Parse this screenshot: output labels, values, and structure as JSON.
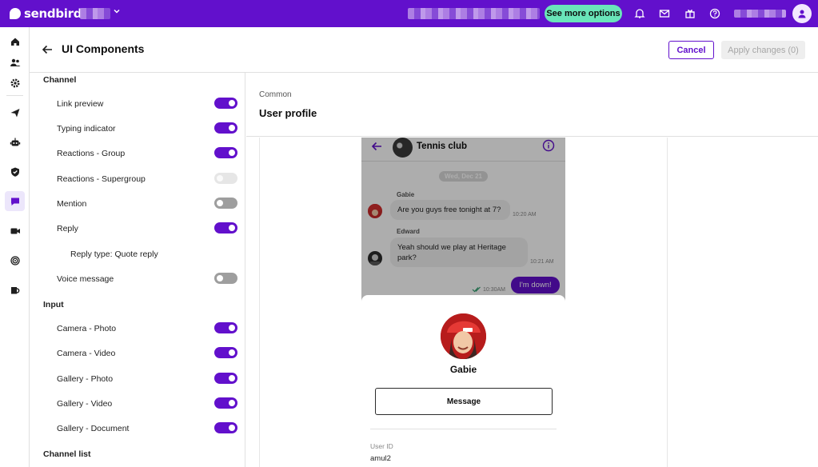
{
  "topbar": {
    "brand": "sendbird",
    "see_more_label": "See more options",
    "colors": {
      "bar": "#6210cc",
      "cta": "#69e5b9"
    },
    "icons": [
      "bell-icon",
      "mail-icon",
      "gift-icon",
      "help-icon",
      "user-icon"
    ]
  },
  "rail": {
    "items": [
      "home-icon",
      "users-icon",
      "settings-icon",
      "send-icon",
      "bot-icon",
      "shield-icon",
      "chat-icon",
      "video-icon",
      "live-icon",
      "desk-icon"
    ],
    "active": "chat-icon"
  },
  "header": {
    "title": "UI Components",
    "cancel_label": "Cancel",
    "apply_label": "Apply changes (0)"
  },
  "settings": {
    "sections": [
      {
        "title": "Channel",
        "rows": [
          {
            "label": "Link preview",
            "toggle": "on"
          },
          {
            "label": "Typing indicator",
            "toggle": "on"
          },
          {
            "label": "Reactions - Group",
            "toggle": "on"
          },
          {
            "label": "Reactions - Supergroup",
            "toggle": "disabled"
          },
          {
            "label": "Mention",
            "toggle": "off"
          },
          {
            "label": "Reply",
            "toggle": "on"
          },
          {
            "label": "Reply type: Quote reply",
            "toggle": "none"
          },
          {
            "label": "Voice message",
            "toggle": "off"
          }
        ]
      },
      {
        "title": "Input",
        "rows": [
          {
            "label": "Camera - Photo",
            "toggle": "on"
          },
          {
            "label": "Camera - Video",
            "toggle": "on"
          },
          {
            "label": "Gallery - Photo",
            "toggle": "on"
          },
          {
            "label": "Gallery - Video",
            "toggle": "on"
          },
          {
            "label": "Gallery - Document",
            "toggle": "on"
          }
        ]
      },
      {
        "title": "Channel list",
        "rows": []
      }
    ]
  },
  "preview": {
    "breadcrumb": "Common",
    "title": "User profile"
  },
  "chat": {
    "channel_name": "Tennis club",
    "date": "Wed, Dec 21",
    "messages": [
      {
        "sender": "Gabie",
        "text": "Are you guys free tonight at 7?",
        "time": "10:20 AM"
      },
      {
        "sender": "Edward",
        "text": "Yeah should we play at Heritage park?",
        "time": "10:21 AM"
      }
    ],
    "outgoing": {
      "text": "I'm down!",
      "time": "10:30AM"
    }
  },
  "profile": {
    "name": "Gabie",
    "message_button": "Message",
    "user_id_label": "User ID",
    "user_id": "amul2"
  }
}
